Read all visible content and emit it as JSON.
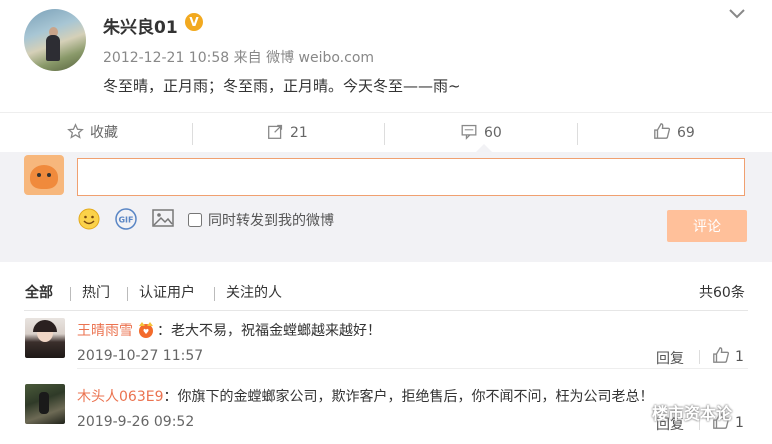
{
  "post": {
    "author": "朱兴良01",
    "verified_badge": "V",
    "timestamp": "2012-12-21 10:58",
    "source_prefix": "来自",
    "source": "微博 weibo.com",
    "content": "冬至晴，正月雨；冬至雨，正月晴。今天冬至——雨~",
    "accent_color": "#f2a91f"
  },
  "actions": {
    "favorite_label": "收藏",
    "repost_count": "21",
    "comment_count": "60",
    "like_count": "69"
  },
  "comment_box": {
    "input_value": "",
    "forward_label": "同时转发到我的微博",
    "submit_label": "评论",
    "tools": [
      "emoji-icon",
      "gif-icon",
      "image-icon"
    ]
  },
  "comment_tabs": {
    "items": [
      "全部",
      "热门",
      "认证用户",
      "关注的人"
    ],
    "total": "共60条"
  },
  "comments": [
    {
      "name": "王晴雨雪",
      "text": "：老大不易，祝福金螳螂越来越好！",
      "time": "2019-10-27 11:57",
      "reply_label": "回复",
      "likes": "1"
    },
    {
      "name": "木头人063E9",
      "text": "：你旗下的金螳螂家公司，欺诈客户，拒绝售后，你不闻不问，枉为公司老总！",
      "time": "2019-9-26 09:52",
      "reply_label": "回复",
      "likes": "1"
    }
  ],
  "watermark": {
    "text": "楼市资本论"
  }
}
